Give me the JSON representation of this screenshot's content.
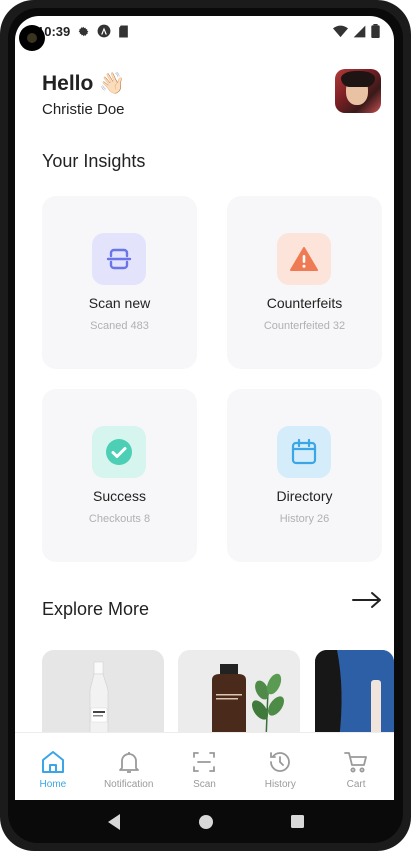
{
  "status_bar": {
    "time": "10:39"
  },
  "header": {
    "greeting": "Hello 👋🏻",
    "user_name": "Christie Doe"
  },
  "insights": {
    "title": "Your Insights",
    "cards": [
      {
        "title": "Scan new",
        "subtitle": "Scaned 483",
        "icon": "scan-icon",
        "icon_color": "#6b74e8",
        "bg": "#e3e4fb"
      },
      {
        "title": "Counterfeits",
        "subtitle": "Counterfeited 32",
        "icon": "warning-icon",
        "icon_color": "#ef7b54",
        "bg": "#fde4da"
      },
      {
        "title": "Success",
        "subtitle": "Checkouts 8",
        "icon": "check-circle-icon",
        "icon_color": "#4ccfb4",
        "bg": "#d6f5ee"
      },
      {
        "title": "Directory",
        "subtitle": "History 26",
        "icon": "calendar-icon",
        "icon_color": "#3aa6e6",
        "bg": "#d5edfa"
      }
    ]
  },
  "explore": {
    "title": "Explore More",
    "products": [
      {
        "label": "bottle-product-image",
        "print": ""
      },
      {
        "label": "brown-bottle-product-image",
        "print": "Amber Bottle Mockup"
      },
      {
        "label": "blue-product-image",
        "print": ""
      }
    ]
  },
  "bottom_nav": {
    "items": [
      {
        "label": "Home",
        "icon": "home-icon",
        "active": true
      },
      {
        "label": "Notification",
        "icon": "bell-icon",
        "active": false
      },
      {
        "label": "Scan",
        "icon": "scan-frame-icon",
        "active": false
      },
      {
        "label": "History",
        "icon": "history-icon",
        "active": false
      },
      {
        "label": "Cart",
        "icon": "cart-icon",
        "active": false
      }
    ]
  },
  "colors": {
    "accent": "#3aa6e6",
    "text": "#222222",
    "muted": "#b0b0b5"
  }
}
